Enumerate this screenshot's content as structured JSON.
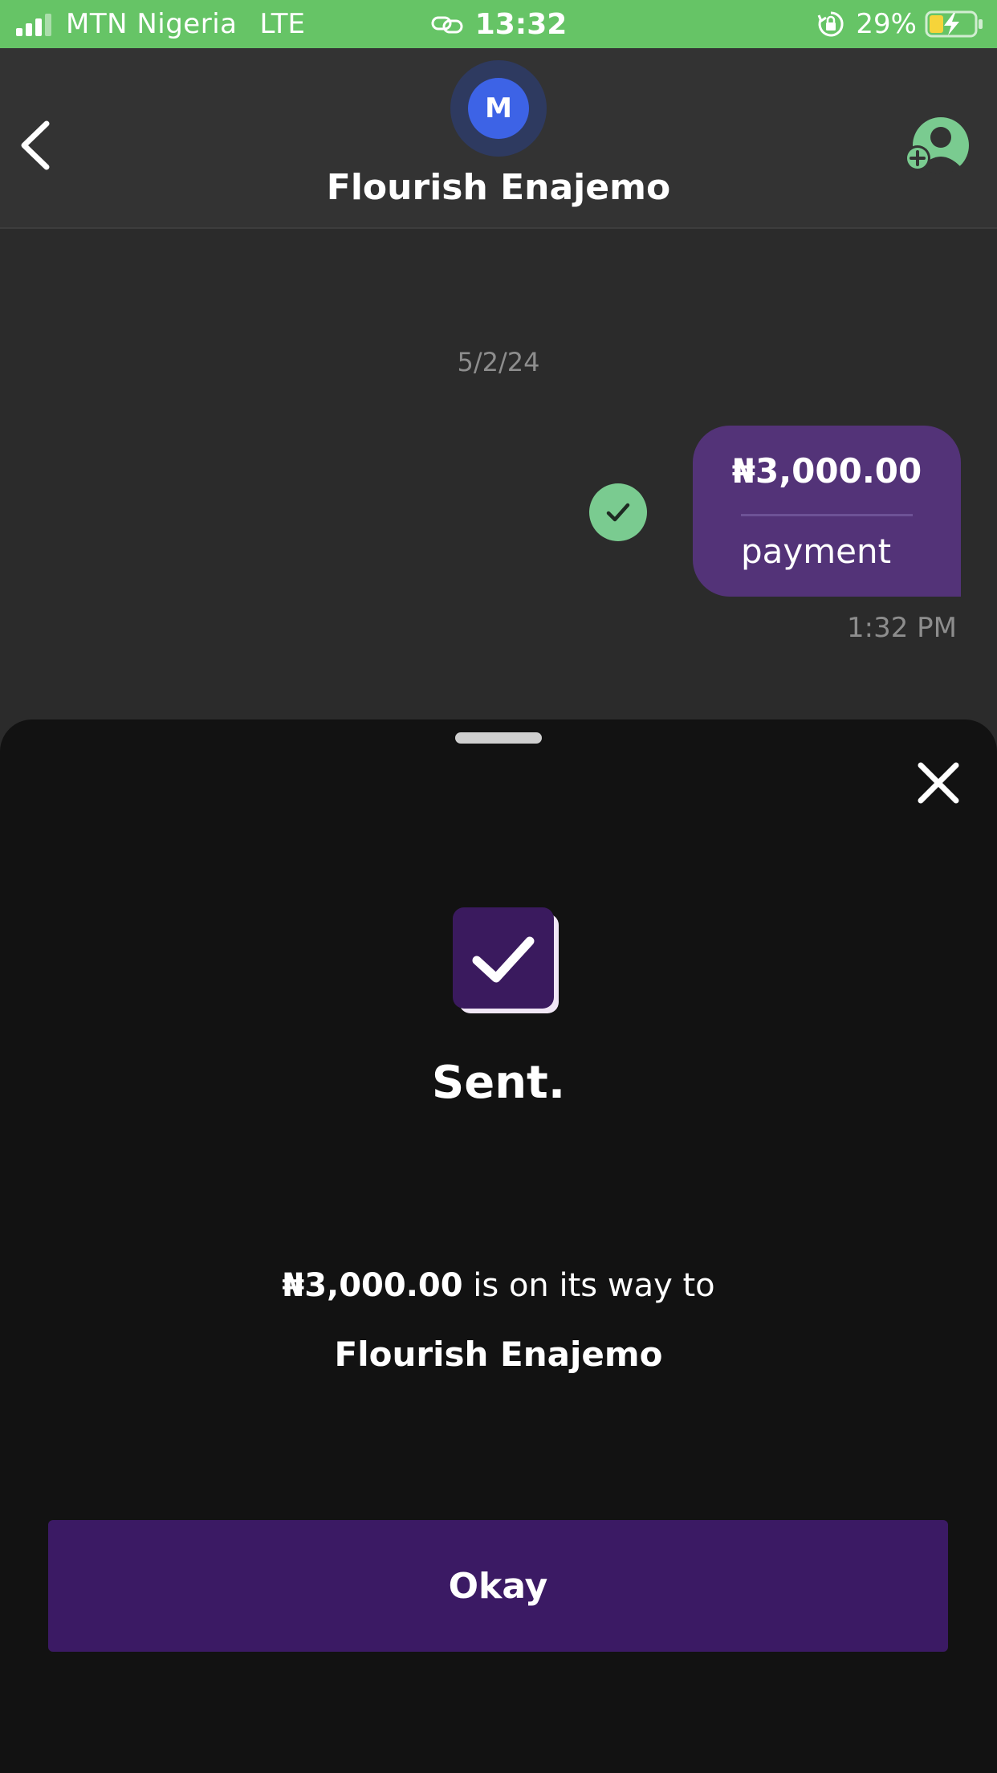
{
  "status_bar": {
    "carrier": "MTN Nigeria",
    "network": "LTE",
    "time": "13:32",
    "battery_percent": "29%",
    "icons": [
      "signal-icon",
      "link-icon",
      "orientation-lock-icon",
      "battery-charging-icon"
    ]
  },
  "header": {
    "avatar_initial": "M",
    "contact_name": "Flourish Enajemo",
    "icons": [
      "back-icon",
      "add-contact-icon"
    ]
  },
  "chat": {
    "date": "5/2/24",
    "message": {
      "amount": "₦3,000.00",
      "note": "payment",
      "time": "1:32 PM",
      "status_icon": "delivered-check-icon"
    }
  },
  "sheet": {
    "title": "Sent.",
    "amount": "₦3,000.00",
    "message_suffix": " is on its way to",
    "recipient": "Flourish Enajemo",
    "button_label": "Okay",
    "icons": [
      "close-icon",
      "success-check-icon"
    ]
  },
  "colors": {
    "status_bar": "#66c466",
    "header_bg": "#333333",
    "chat_bg": "#2b2b2b",
    "bubble": "#533378",
    "delivered": "#7acb90",
    "sheet_bg": "#121212",
    "button": "#3b1a64",
    "avatar": "#3d63e6"
  }
}
